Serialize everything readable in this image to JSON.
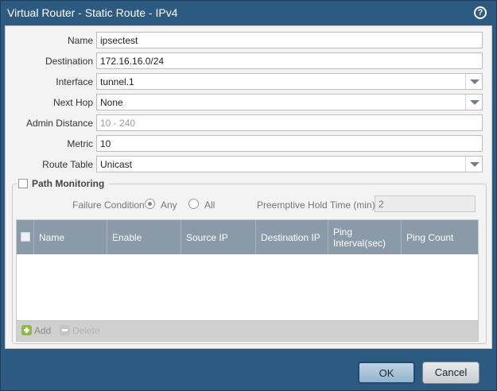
{
  "window": {
    "title": "Virtual Router - Static Route - IPv4",
    "help_icon": "?"
  },
  "form": {
    "name": {
      "label": "Name",
      "value": "ipsectest"
    },
    "destination": {
      "label": "Destination",
      "value": "172.16.16.0/24"
    },
    "interface": {
      "label": "Interface",
      "value": "tunnel.1"
    },
    "next_hop": {
      "label": "Next Hop",
      "value": "None"
    },
    "admin_distance": {
      "label": "Admin Distance",
      "placeholder": "10 - 240"
    },
    "metric": {
      "label": "Metric",
      "value": "10"
    },
    "route_table": {
      "label": "Route Table",
      "value": "Unicast"
    }
  },
  "path_monitoring": {
    "label": "Path Monitoring",
    "checked": false,
    "failure_condition": {
      "label": "Failure Condition",
      "any_label": "Any",
      "all_label": "All",
      "selected": "Any"
    },
    "preemptive_hold_time": {
      "label": "Preemptive Hold Time (min)",
      "value": "2"
    },
    "columns": [
      "Name",
      "Enable",
      "Source IP",
      "Destination IP",
      "Ping Interval(sec)",
      "Ping Count"
    ],
    "rows": [],
    "add_label": "Add",
    "delete_label": "Delete"
  },
  "buttons": {
    "ok": "OK",
    "cancel": "Cancel"
  },
  "colors": {
    "titlebar": "#2d5a80",
    "grid_header": "#8b9aa8",
    "add_icon": "#8dbb3c"
  }
}
